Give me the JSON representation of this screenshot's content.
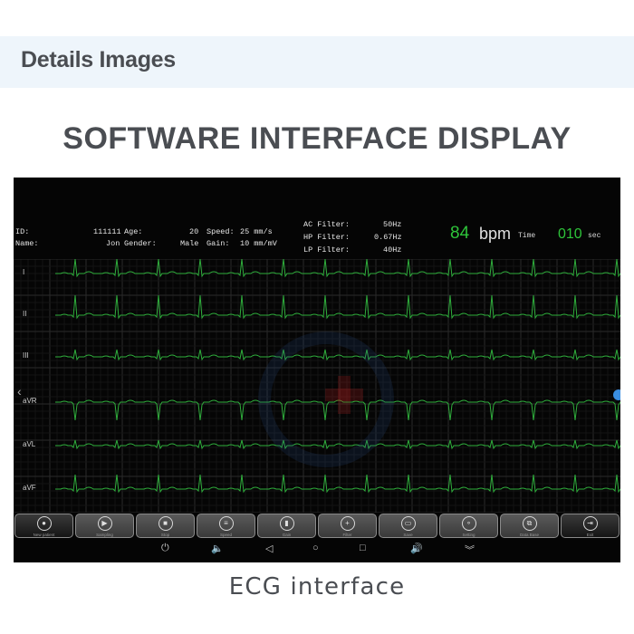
{
  "page": {
    "section_title": "Details Images",
    "heading": "SOFTWARE INTERFACE DISPLAY",
    "caption": "ECG interface"
  },
  "ecg_screen": {
    "patient": {
      "id_label": "ID:",
      "id_value": "111111",
      "name_label": "Name:",
      "name_value": "Jon",
      "age_label": "Age:",
      "age_value": "20",
      "gender_label": "Gender:",
      "gender_value": "Male",
      "speed_label": "Speed:",
      "speed_value": "25 mm/s",
      "gain_label": "Gain:",
      "gain_value": "10 mm/mV"
    },
    "filters": [
      {
        "label": "AC Filter:",
        "value": "50Hz"
      },
      {
        "label": "HP Filter:",
        "value": "0.67Hz"
      },
      {
        "label": "LP Filter:",
        "value": "40Hz"
      }
    ],
    "heart_rate": {
      "value": "84",
      "unit": "bpm"
    },
    "timer": {
      "label": "Time",
      "value": "010",
      "unit": "sec"
    },
    "leads": [
      "I",
      "II",
      "III",
      "aVR",
      "aVL",
      "aVF"
    ],
    "trace_color": "#2fae3c",
    "toolbar": [
      {
        "label": "New patient",
        "icon": "user-icon",
        "glyph": "●"
      },
      {
        "label": "Sampling",
        "icon": "play-icon",
        "glyph": "▶"
      },
      {
        "label": "Stop",
        "icon": "stop-icon",
        "glyph": "■"
      },
      {
        "label": "Speed",
        "icon": "speed-icon",
        "glyph": "≡"
      },
      {
        "label": "Gain",
        "icon": "gain-icon",
        "glyph": "▮"
      },
      {
        "label": "Filter",
        "icon": "filter-icon",
        "glyph": "+"
      },
      {
        "label": "Save",
        "icon": "save-icon",
        "glyph": "▭"
      },
      {
        "label": "Setting",
        "icon": "setting-icon",
        "glyph": "∘"
      },
      {
        "label": "Data Base",
        "icon": "database-icon",
        "glyph": "⧉"
      },
      {
        "label": "Exit",
        "icon": "exit-icon",
        "glyph": "⇥"
      }
    ],
    "system_bar": [
      {
        "name": "power-icon",
        "glyph": "⏻"
      },
      {
        "name": "volume-down-icon",
        "glyph": "🔈"
      },
      {
        "name": "back-icon",
        "glyph": "◁"
      },
      {
        "name": "home-icon",
        "glyph": "○"
      },
      {
        "name": "recents-icon",
        "glyph": "□"
      },
      {
        "name": "volume-up-icon",
        "glyph": "🔊"
      },
      {
        "name": "collapse-icon",
        "glyph": "︾"
      }
    ]
  }
}
